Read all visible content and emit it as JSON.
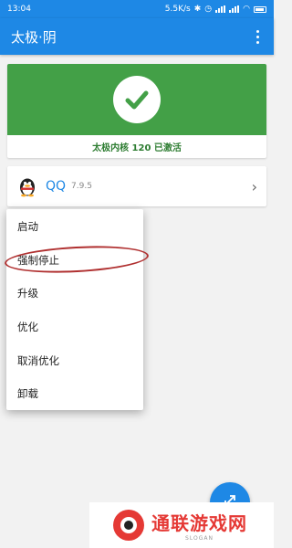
{
  "status_bar": {
    "time": "13:04",
    "network_speed": "5.5K/s"
  },
  "app_bar": {
    "title": "太极·阴",
    "overflow_icon": "more-vert-icon"
  },
  "status_card": {
    "text": "太极内核 120 已激活",
    "icon": "check-circle-icon",
    "color": "#43a047"
  },
  "module": {
    "name": "QQ",
    "version": "7.9.5",
    "icon": "qq-penguin-icon"
  },
  "context_menu": {
    "items": [
      {
        "label": "启动"
      },
      {
        "label": "强制停止"
      },
      {
        "label": "升级"
      },
      {
        "label": "优化"
      },
      {
        "label": "取消优化"
      },
      {
        "label": "卸载"
      }
    ],
    "highlighted_index": 1
  },
  "fab": {
    "icon": "expand-icon"
  },
  "watermark": {
    "title": "通联游戏网",
    "subtitle": "SLOGAN"
  },
  "colors": {
    "primary": "#1e88e5",
    "success": "#43a047",
    "annotation": "#b03030",
    "watermark": "#e53935"
  }
}
